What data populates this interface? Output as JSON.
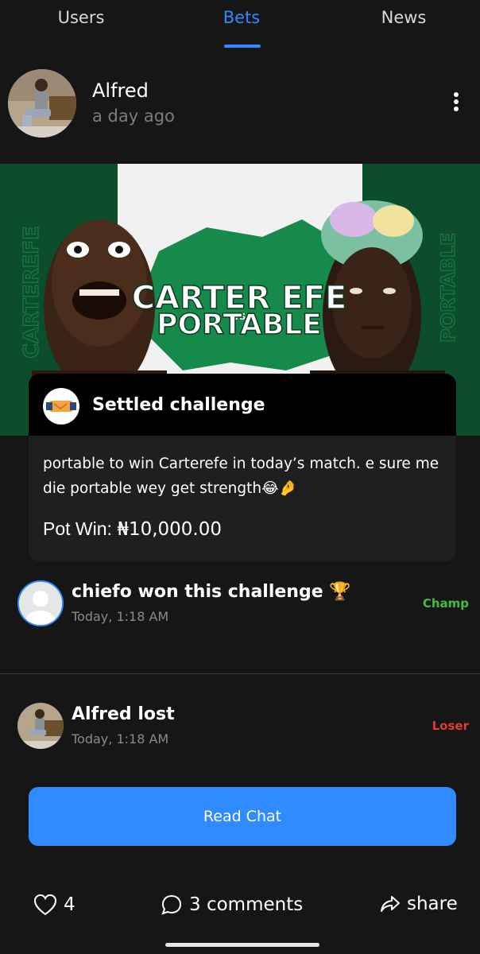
{
  "tabs": [
    {
      "label": "Users",
      "active": false
    },
    {
      "label": "Bets",
      "active": true
    },
    {
      "label": "News",
      "active": false
    }
  ],
  "post": {
    "author": "Alfred",
    "time": "a day ago",
    "menu_icon": "more-vertical-icon"
  },
  "banner": {
    "headline_line1": "CARTER EFE",
    "vs": "VS",
    "headline_line2": "PORTABLE",
    "side_left": "CARTEREFE",
    "side_right": "PORTABLE"
  },
  "challenge": {
    "title": "Settled challenge",
    "icon": "handshake-icon",
    "text": "portable to win Carterefe in today’s match. e sure me die portable wey get strength😂🤌",
    "pot_label": "Pot Win:",
    "pot_value": "₦10,000.00"
  },
  "winner": {
    "title": "chiefo won this challenge 🏆",
    "time": "Today, 1:18 AM",
    "badge": "Champ"
  },
  "loser": {
    "title": "Alfred lost",
    "time": "Today, 1:18 AM",
    "badge": "Loser"
  },
  "read_chat_label": "Read Chat",
  "actions": {
    "likes": "4",
    "comments": "3 comments",
    "share": "share"
  },
  "colors": {
    "accent": "#2f8bff",
    "champ": "#3fbf3f",
    "loser": "#e53935",
    "background": "#161616"
  }
}
